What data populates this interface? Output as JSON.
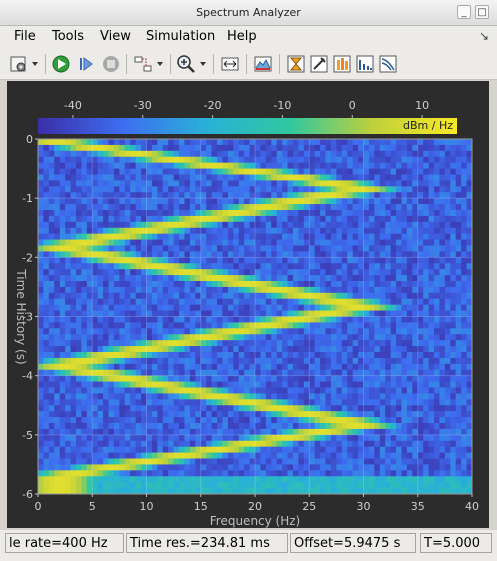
{
  "window": {
    "title": "Spectrum Analyzer"
  },
  "menu": {
    "items": [
      "File",
      "Tools",
      "View",
      "Simulation",
      "Help"
    ]
  },
  "toolbar": {
    "icons": [
      "settings-icon",
      "play-icon",
      "step-forward-icon",
      "stop-icon",
      "signal-select-icon",
      "zoom-in-icon",
      "autoscale-icon",
      "spectrum-settings-icon",
      "peak-finder-icon",
      "cursor-measurements-icon",
      "channel-measurements-icon",
      "distortion-measurements-icon",
      "ccdf-measurements-icon"
    ]
  },
  "chart_data": {
    "type": "heatmap",
    "title": "",
    "xlabel": "Frequency (Hz)",
    "ylabel": "Time History (s)",
    "x_ticks": [
      "0",
      "5",
      "10",
      "15",
      "20",
      "25",
      "30",
      "35",
      "40"
    ],
    "y_ticks": [
      "0",
      "-1",
      "-2",
      "-3",
      "-4",
      "-5",
      "-6"
    ],
    "xlim": [
      0,
      40
    ],
    "ylim": [
      -6,
      0
    ],
    "colorbar": {
      "label": "dBm / Hz",
      "ticks": [
        "-40",
        "-30",
        "-20",
        "-10",
        "0",
        "10"
      ],
      "range": [
        -45,
        15
      ],
      "colors": [
        "#3b2fa6",
        "#3e6cf0",
        "#2ab0d8",
        "#2fc8a0",
        "#bfd03a",
        "#f9e926"
      ]
    },
    "series": [
      {
        "description": "chirp peak frequency vs time",
        "points": [
          [
            0,
            0
          ],
          [
            30,
            -0.83
          ],
          [
            2,
            -1.83
          ],
          [
            30,
            -2.83
          ],
          [
            2,
            -3.83
          ],
          [
            30,
            -4.83
          ],
          [
            2,
            -5.7
          ]
        ]
      }
    ],
    "noise_floor_dbm_hz": -35,
    "peak_dbm_hz": 10
  },
  "status": {
    "sample_rate": "le rate=400 Hz",
    "time_res": "Time res.=234.81 ms",
    "offset": "Offset=5.9475 s",
    "time": "T=5.000"
  }
}
